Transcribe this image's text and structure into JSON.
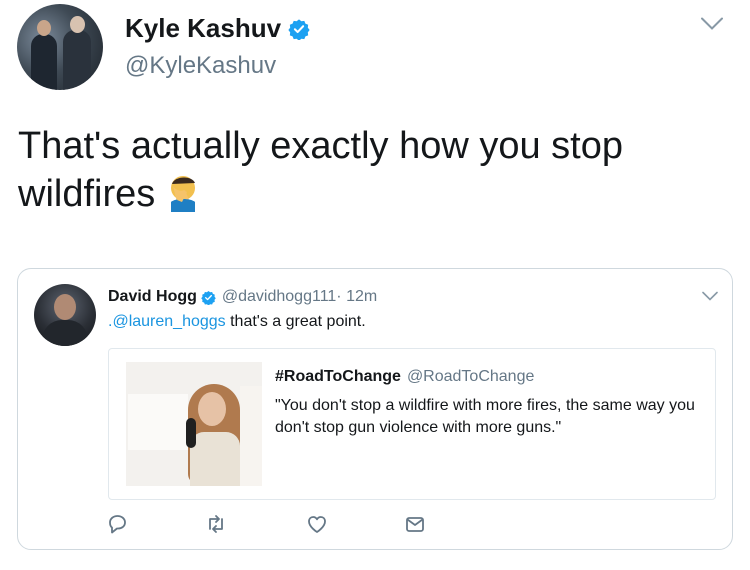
{
  "tweet": {
    "display_name": "Kyle Kashuv",
    "handle": "@KyleKashuv",
    "text": "That's actually exactly how you stop wildfires",
    "emoji": "man-facepalming"
  },
  "quoted": {
    "display_name": "David Hogg",
    "handle": "@davidhogg111",
    "time": " · 12m",
    "mention": ".@lauren_hoggs",
    "text_rest": " that's a great point."
  },
  "inner": {
    "display_name": "#RoadToChange",
    "handle": "@RoadToChange",
    "text": "\"You don't stop a wildfire with more fires, the same way you don't stop gun violence with more guns.\""
  },
  "colors": {
    "verified": "#1da1f2",
    "link": "#1b95e0",
    "muted": "#657786"
  },
  "icons": [
    "verified-badge-icon",
    "chevron-down-icon",
    "reply-icon",
    "retweet-icon",
    "like-icon",
    "direct-message-icon"
  ]
}
